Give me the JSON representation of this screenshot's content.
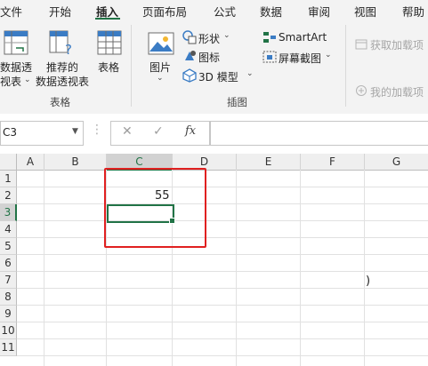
{
  "tabs": [
    "文件",
    "开始",
    "插入",
    "页面布局",
    "公式",
    "数据",
    "审阅",
    "视图",
    "帮助"
  ],
  "active_tab": "插入",
  "ribbon": {
    "tables_group": {
      "recommended_pivot_line1": "数据透",
      "recommended_pivot_line2": "视表",
      "recommended_table_line1": "推荐的",
      "recommended_table_line2": "数据透视表",
      "table": "表格",
      "label": "表格"
    },
    "illustrations_group": {
      "picture": "图片",
      "shapes": "形状",
      "icons": "图标",
      "model3d": "3D 模型",
      "smartart": "SmartArt",
      "screenshot": "屏幕截图",
      "label": "插图"
    },
    "addins_group": {
      "get_addins": "获取加载项",
      "my_addins": "我的加载项"
    }
  },
  "formula_bar": {
    "name_box": "C3",
    "fx": "fx",
    "cancel": "✕",
    "confirm": "✓",
    "content": ""
  },
  "columns": [
    "A",
    "B",
    "C",
    "D",
    "E",
    "F",
    "G"
  ],
  "selected_column": "C",
  "rows": [
    "1",
    "2",
    "3",
    "4",
    "5",
    "6",
    "7",
    "8",
    "9",
    "10",
    "11"
  ],
  "selected_row": "3",
  "cells": {
    "C2": "55",
    "G7": ")"
  },
  "colors": {
    "accent": "#217346",
    "highlight_box": "#e02020"
  }
}
